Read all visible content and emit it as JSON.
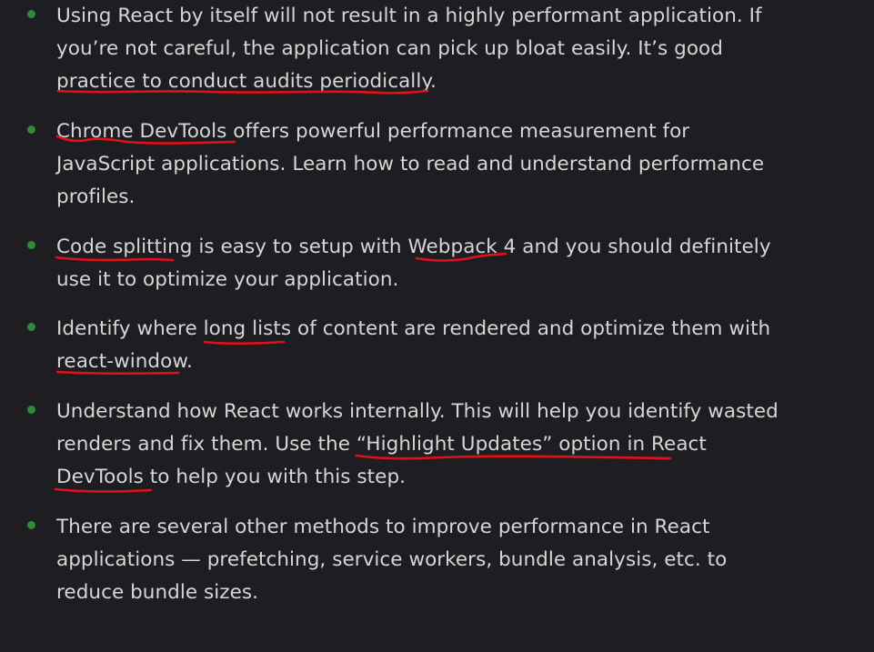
{
  "bullets": [
    {
      "lines": [
        "Using React by itself will not result in a highly performant application. If",
        "you’re not careful, the application can pick up bloat easily. It’s good",
        "practice to conduct audits periodically."
      ]
    },
    {
      "lines": [
        "Chrome DevTools offers powerful performance measurement for",
        "JavaScript applications. Learn how to read and understand performance",
        "profiles."
      ]
    },
    {
      "lines": [
        "Code splitting is easy to setup with Webpack 4 and you should definitely",
        "use it to optimize your application."
      ]
    },
    {
      "lines": [
        "Identify where long lists of content are rendered and optimize them with",
        "react-window."
      ]
    },
    {
      "lines": [
        "Understand how React works internally. This will help you identify wasted",
        "renders and fix them. Use the “Highlight Updates” option in React",
        "DevTools to help you with this step."
      ]
    },
    {
      "lines": [
        "There are several other methods to improve performance in React",
        "applications — prefetching, service workers, bundle analysis, etc. to",
        "reduce bundle sizes."
      ]
    }
  ],
  "underlined_phrases": [
    "practice to conduct audits periodically",
    "Chrome DevTools",
    "Code splitting",
    "Webpack 4",
    "long lists",
    "react-window",
    "Highlight Updates” option in React",
    "DevTools"
  ],
  "colors": {
    "background": "#1e1e22",
    "text": "#d6d6d6",
    "bullet": "#2f8a3a",
    "annotation": "#e3101c"
  }
}
